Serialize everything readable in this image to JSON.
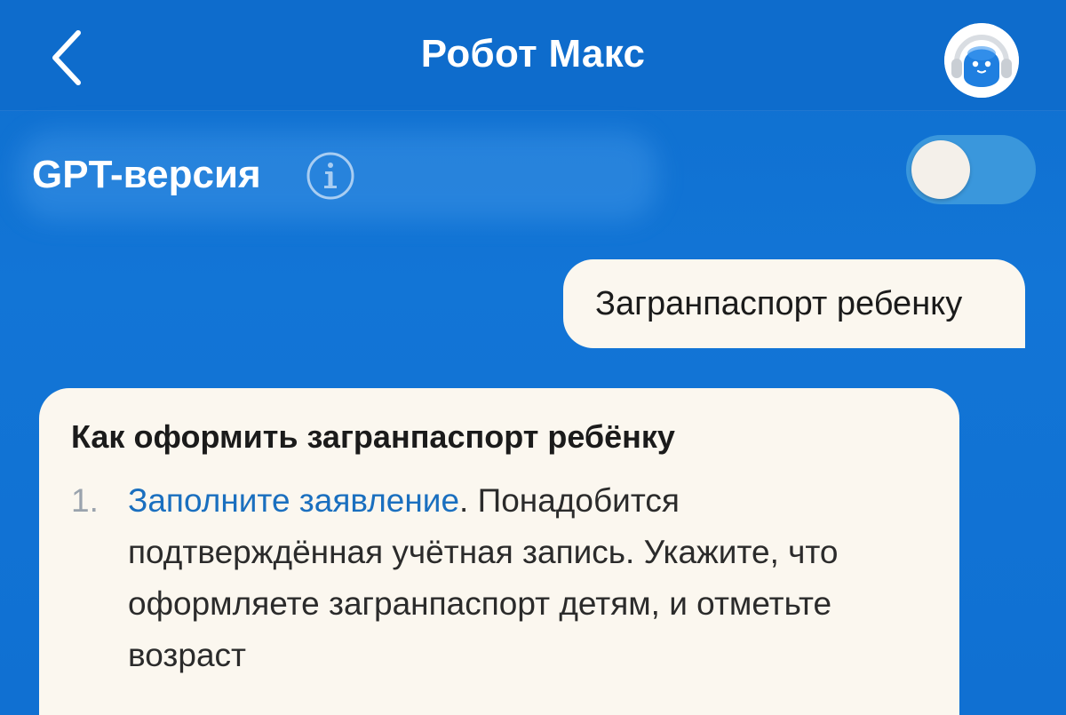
{
  "header": {
    "title": "Робот Макс",
    "back_icon": "chevron-left-icon",
    "avatar_icon": "robot-avatar-icon"
  },
  "gpt": {
    "label": "GPT-версия",
    "info_icon": "info-icon",
    "toggle_on": false
  },
  "chat": {
    "user_message": "Загранпаспорт ребенку",
    "bot_message": {
      "title": "Как оформить загранпаспорт ребёнку",
      "steps": [
        {
          "number": "1.",
          "link": "Заполните заявление",
          "text": ". Понадобится подтверждённая учётная запись. Укажите, что оформляете загранпаспорт детям, и отметьте возраст"
        }
      ]
    }
  },
  "colors": {
    "background": "#1070d2",
    "header": "#0e6ccc",
    "bubble": "#fbf7ef",
    "link": "#1a6fbf",
    "toggle_track": "#3a97dc"
  }
}
